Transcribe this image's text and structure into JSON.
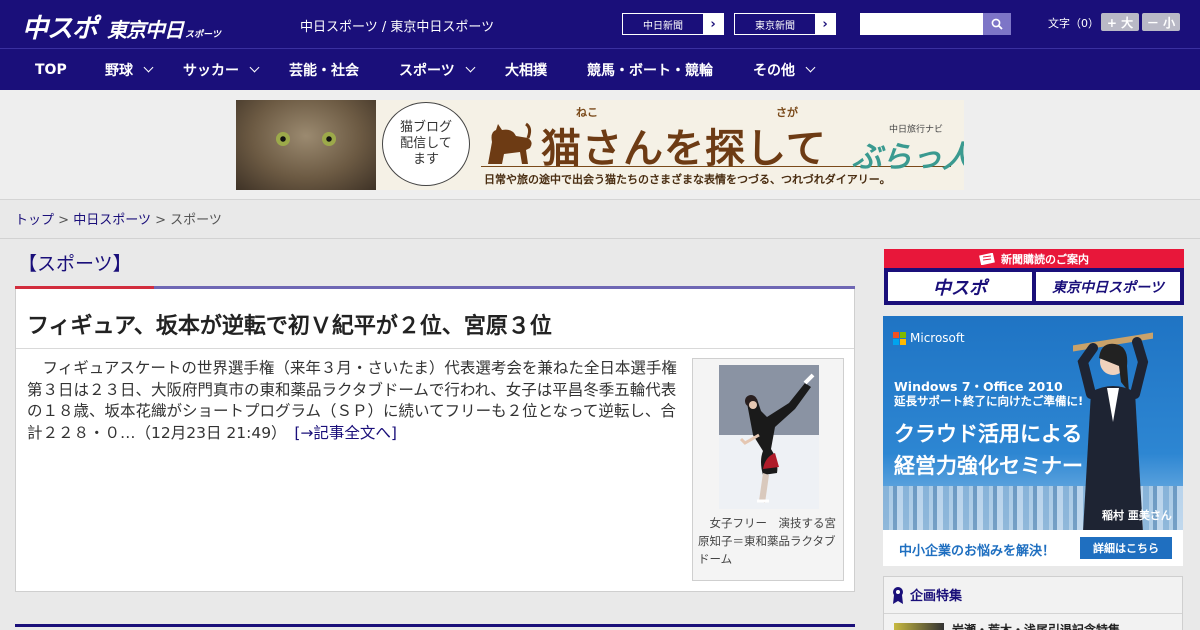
{
  "header": {
    "logo_part1": "中スポ",
    "logo_part2": "東京中日",
    "logo_part3": "スポーツ",
    "site_name": "中日スポーツ / 東京中日スポーツ",
    "paper_links": [
      {
        "label": "中日新聞",
        "arrow": "›"
      },
      {
        "label": "東京新聞",
        "arrow": "›"
      }
    ],
    "search": {
      "placeholder": "",
      "icon": "search-icon"
    },
    "font_size": {
      "label": "文字（0）",
      "increase": "+ 大",
      "decrease": "－ 小"
    }
  },
  "nav": {
    "items": [
      {
        "label": "TOP",
        "has_dropdown": false
      },
      {
        "label": "野球",
        "has_dropdown": true
      },
      {
        "label": "サッカー",
        "has_dropdown": true
      },
      {
        "label": "芸能・社会",
        "has_dropdown": false
      },
      {
        "label": "スポーツ",
        "has_dropdown": true
      },
      {
        "label": "大相撲",
        "has_dropdown": false
      },
      {
        "label": "競馬・ボート・競輪",
        "has_dropdown": false
      },
      {
        "label": "その他",
        "has_dropdown": true
      }
    ]
  },
  "banner": {
    "ruby1": "ねこ",
    "ruby2": "さが",
    "bubble_text": "猫ブログ\n配信して\nます",
    "title": "猫さんを探して",
    "subtitle": "日常や旅の途中で出会う猫たちのさまざまな表情をつづる、つれづれダイアリー。",
    "brand_small": "中日旅行ナビ",
    "brand": "ぶらっ人"
  },
  "breadcrumb": {
    "items": [
      "トップ",
      "中日スポーツ"
    ],
    "separator": ">",
    "current": "スポーツ"
  },
  "main": {
    "section_heading": "【スポーツ】",
    "article": {
      "title": "フィギュア、坂本が逆転で初Ｖ紀平が２位、宮原３位",
      "body": "フィギュアスケートの世界選手権（来年３月・さいたま）代表選考会を兼ねた全日本選手権第３日は２３日、大阪府門真市の東和薬品ラクタブドームで行われ、女子は平昌冬季五輪代表の１８歳、坂本花織がショートプログラム（ＳＰ）に続いてフリーも２位となって逆転し、合計２２８・０…",
      "timestamp": "（12月23日 21:49）",
      "read_more": "[→記事全文へ]",
      "photo_caption": "女子フリー　演技する宮原知子＝東和薬品ラクタブドーム"
    }
  },
  "sidebar": {
    "subscribe": {
      "header": "新聞購読のご案内",
      "buttons": [
        "中スポ",
        "東京中日スポーツ"
      ]
    },
    "ad": {
      "brand": "Microsoft",
      "line1": "Windows 7・Office 2010",
      "line2": "延長サポート終了に向けたご準備に!",
      "line3": "クラウド活用による",
      "line4": "経営力強化セミナー",
      "person_name": "稲村 亜美さん",
      "footer_text": "中小企業のお悩みを解決！",
      "footer_button": "詳細はこちら",
      "colors": {
        "red": "#f25022",
        "green": "#7fba00",
        "blue": "#00a4ef",
        "yellow": "#ffb900"
      }
    },
    "feature": {
      "header": "企画特集",
      "item": "岩瀬・荒木・浅尾引退記念特集"
    }
  },
  "colors": {
    "brand_navy": "#1a0f7a",
    "accent_red": "#d22d3d",
    "accent_purple": "#6f67b4"
  }
}
